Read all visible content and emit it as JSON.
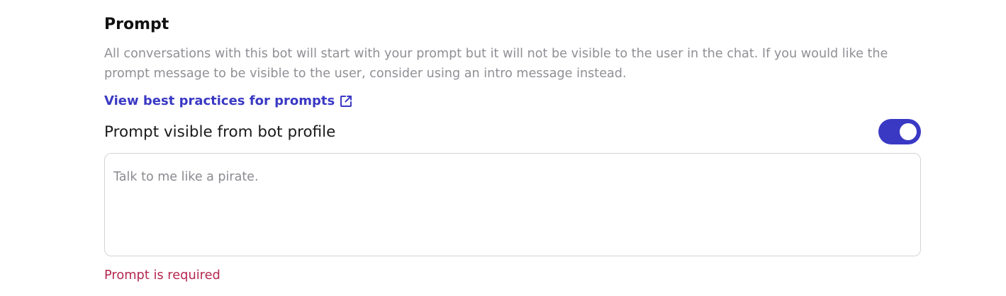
{
  "prompt_section": {
    "title": "Prompt",
    "description": "All conversations with this bot will start with your prompt but it will not be visible to the user in the chat. If you would like the prompt message to be visible to the user, consider using an intro message instead.",
    "best_practices_link": {
      "label": "View best practices for prompts",
      "icon": "external-link-icon"
    },
    "visibility_toggle": {
      "label": "Prompt visible from bot profile",
      "state": "on"
    },
    "prompt_input": {
      "value": "",
      "placeholder": "Talk to me like a pirate."
    },
    "error_message": "Prompt is required"
  },
  "colors": {
    "accent": "#3a39c4",
    "muted_text": "#8f8f95",
    "error": "#b4274f",
    "border": "#d4d4d8"
  }
}
